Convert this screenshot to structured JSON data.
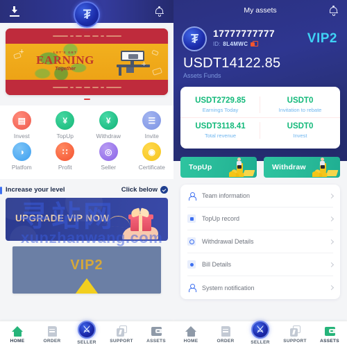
{
  "left": {
    "header": {
      "download_icon": "download-icon",
      "logo": "₮",
      "bell_icon": "bell-icon"
    },
    "banner": {
      "pre_text": "LET'S GET",
      "title": "EARNING",
      "script_text": "Together",
      "dots_active_index": 0
    },
    "grid": [
      {
        "label": "Invest",
        "glyph": "▤",
        "cls": "invest",
        "icon": "invest-icon"
      },
      {
        "label": "TopUp",
        "glyph": "¥",
        "cls": "topup",
        "icon": "topup-icon"
      },
      {
        "label": "Withdraw",
        "glyph": "¥",
        "cls": "withdraw",
        "icon": "withdraw-icon"
      },
      {
        "label": "Invite",
        "glyph": "☰",
        "cls": "invite",
        "icon": "invite-icon"
      },
      {
        "label": "Platfom",
        "glyph": "◑",
        "cls": "platform",
        "icon": "platform-icon"
      },
      {
        "label": "Profit",
        "glyph": "∷",
        "cls": "profit",
        "icon": "profit-icon"
      },
      {
        "label": "Seller",
        "glyph": "◎",
        "cls": "seller",
        "icon": "seller-icon"
      },
      {
        "label": "Certificate",
        "glyph": "◉",
        "cls": "cert",
        "icon": "certificate-icon"
      }
    ],
    "section": {
      "title": "Increase your level",
      "action": "Click below",
      "check_icon": "check-circle-icon"
    },
    "upgrade_banner": {
      "text": "UPGRADE VIP NOW"
    },
    "vip_card": {
      "label": "VIP2"
    },
    "watermark": {
      "cn": "寻站网",
      "en": "xunzhanwang.com"
    },
    "tabs": [
      {
        "label": "HOME",
        "icon": "home-icon",
        "active": true
      },
      {
        "label": "ORDER",
        "icon": "order-icon",
        "active": false
      },
      {
        "label": "SELLER",
        "icon": "seller-center-icon",
        "glyph": "⚔",
        "active": false
      },
      {
        "label": "SUPPORT",
        "icon": "support-icon",
        "active": false
      },
      {
        "label": "ASSETS",
        "icon": "assets-icon",
        "active": false
      }
    ]
  },
  "right": {
    "header": {
      "title": "My assets",
      "bell_icon": "bell-icon"
    },
    "account": {
      "avatar_glyph": "₮",
      "phone": "17777777777",
      "id_label": "ID:",
      "id_value": "8L4MWC",
      "copy_icon": "copy-icon",
      "vip_badge": "VIP2"
    },
    "balance": {
      "amount": "USDT14122.85",
      "caption": "Assets Funds"
    },
    "stats": [
      {
        "value": "USDT2729.85",
        "label": "Earnings Today"
      },
      {
        "value": "USDT0",
        "label": "Invitation to rebate"
      },
      {
        "value": "USDT3118.41",
        "label": "Total revenue"
      },
      {
        "value": "USDT0",
        "label": "Invest"
      }
    ],
    "actions": [
      {
        "label": "TopUp",
        "name": "topup-button"
      },
      {
        "label": "Withdraw",
        "name": "withdraw-button"
      }
    ],
    "menu": [
      {
        "label": "Team information",
        "icon": "person-icon"
      },
      {
        "label": "TopUp record",
        "icon": "record-icon"
      },
      {
        "label": "Withdrawal Details",
        "icon": "withdraw-detail-icon"
      },
      {
        "label": "Bill Details",
        "icon": "bill-icon"
      },
      {
        "label": "System notification",
        "icon": "notification-icon"
      }
    ],
    "tabs": [
      {
        "label": "HOME",
        "icon": "home-icon",
        "active": false
      },
      {
        "label": "ORDER",
        "icon": "order-icon",
        "active": false
      },
      {
        "label": "SELLER",
        "icon": "seller-center-icon",
        "glyph": "⚔",
        "active": false
      },
      {
        "label": "SUPPORT",
        "icon": "support-icon",
        "active": false
      },
      {
        "label": "ASSETS",
        "icon": "assets-icon",
        "active": true
      }
    ]
  },
  "colors": {
    "header_blue": "#2e3590",
    "accent_green": "#13b97a",
    "accent_cyan": "#3fd2f5",
    "accent_blue": "#3d6ff0",
    "banner_red": "#bf2b3c",
    "banner_yellow": "#f2b01e",
    "gold": "#d6a83a"
  }
}
